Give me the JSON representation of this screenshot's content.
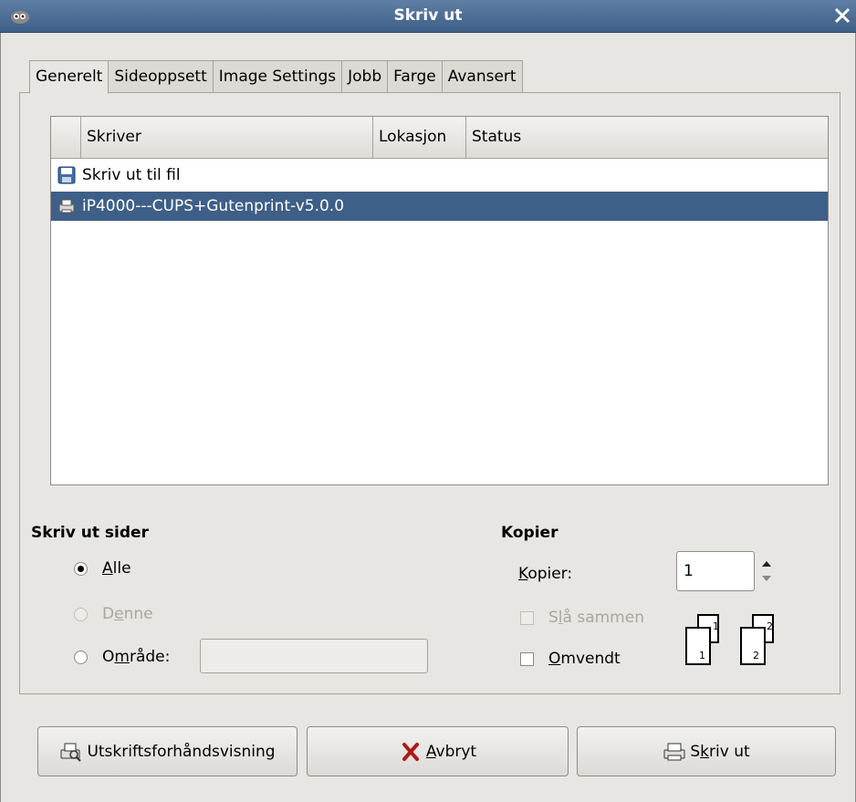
{
  "window": {
    "title": "Skriv ut"
  },
  "tabs": [
    {
      "label": "Generelt",
      "active": true
    },
    {
      "label": "Sideoppsett",
      "active": false
    },
    {
      "label": "Image Settings",
      "active": false
    },
    {
      "label": "Jobb",
      "active": false
    },
    {
      "label": "Farge",
      "active": false
    },
    {
      "label": "Avansert",
      "active": false
    }
  ],
  "printer_list": {
    "columns": [
      "Skriver",
      "Lokasjon",
      "Status"
    ],
    "rows": [
      {
        "name": "Skriv ut til fil",
        "icon": "save-to-file-icon",
        "selected": false
      },
      {
        "name": "iP4000---CUPS+Gutenprint-v5.0.0",
        "icon": "printer-icon",
        "selected": true
      }
    ]
  },
  "print_pages": {
    "title": "Skriv ut sider",
    "all": {
      "pre": "",
      "mnemonic": "A",
      "post": "lle",
      "checked": true
    },
    "current": {
      "pre": "D",
      "mnemonic": "e",
      "post": "nne",
      "disabled": true
    },
    "range": {
      "pre": "O",
      "mnemonic": "m",
      "post": "råde:",
      "value": ""
    }
  },
  "copies": {
    "title": "Kopier",
    "label_pre": "",
    "label_mnemonic": "K",
    "label_post": "opier:",
    "value": "1",
    "collate": {
      "pre": "S",
      "mnemonic": "l",
      "post": "å sammen",
      "disabled": true
    },
    "reverse": {
      "pre": "",
      "mnemonic": "O",
      "post": "mvendt"
    }
  },
  "buttons": {
    "preview": "Utskriftsforhåndsvisning",
    "cancel": {
      "pre": "",
      "mnemonic": "A",
      "post": "vbryt"
    },
    "print": {
      "pre": "S",
      "mnemonic": "k",
      "post": "riv ut"
    }
  },
  "colors": {
    "selection": "#3e5f88",
    "titlebar": "#4d6d95"
  }
}
